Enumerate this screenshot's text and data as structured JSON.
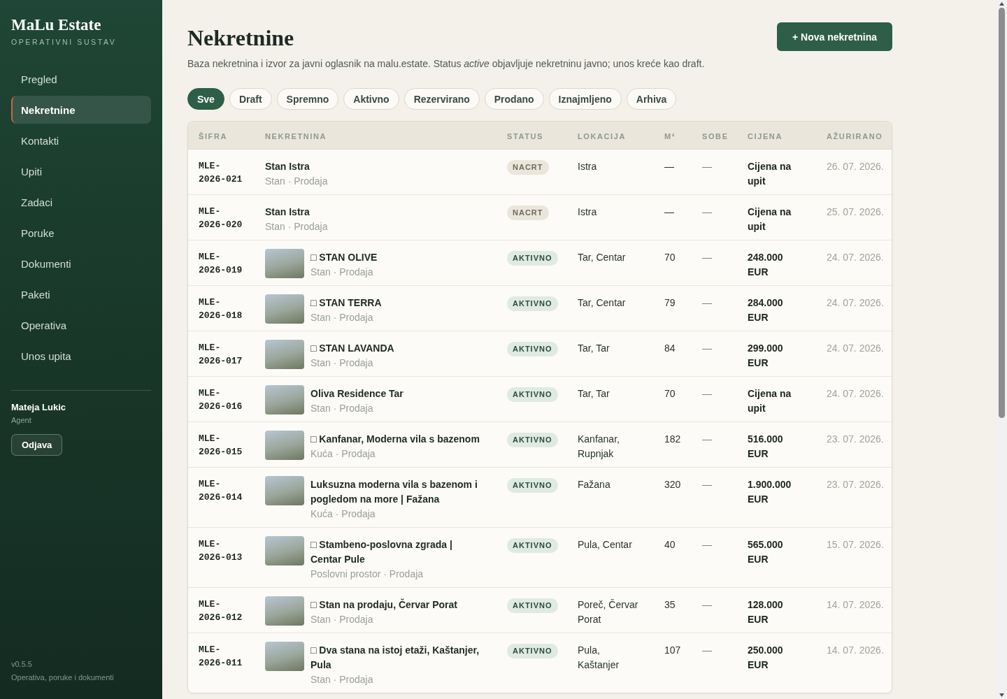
{
  "sidebar": {
    "brand": "MaLu Estate",
    "tagline": "OPERATIVNI SUSTAV",
    "items": [
      {
        "label": "Pregled",
        "selected": false
      },
      {
        "label": "Nekretnine",
        "selected": true
      },
      {
        "label": "Kontakti",
        "selected": false
      },
      {
        "label": "Upiti",
        "selected": false
      },
      {
        "label": "Zadaci",
        "selected": false
      },
      {
        "label": "Poruke",
        "selected": false
      },
      {
        "label": "Dokumenti",
        "selected": false
      },
      {
        "label": "Paketi",
        "selected": false
      },
      {
        "label": "Operativa",
        "selected": false
      },
      {
        "label": "Unos upita",
        "selected": false
      }
    ],
    "user": {
      "name": "Mateja Lukic",
      "role": "Agent",
      "logout": "Odjava"
    },
    "version": "v0.5.5",
    "footer": "Operativa, poruke i dokumenti"
  },
  "header": {
    "title": "Nekretnine",
    "description": "Baza nekretnina i izvor za javni oglasnik na malu.estate. Status *active* objavljuje nekretninu javno; unos kreće kao draft.",
    "new_button": "+ Nova nekretnina"
  },
  "filters": [
    {
      "label": "Sve",
      "selected": true
    },
    {
      "label": "Draft",
      "selected": false
    },
    {
      "label": "Spremno",
      "selected": false
    },
    {
      "label": "Aktivno",
      "selected": false
    },
    {
      "label": "Rezervirano",
      "selected": false
    },
    {
      "label": "Prodano",
      "selected": false
    },
    {
      "label": "Iznajmljeno",
      "selected": false
    },
    {
      "label": "Arhiva",
      "selected": false
    }
  ],
  "table": {
    "columns": [
      "ŠIFRA",
      "NEKRETNINA",
      "STATUS",
      "LOKACIJA",
      "M²",
      "SOBE",
      "CIJENA",
      "AŽURIRANO"
    ],
    "rows": [
      {
        "code": "MLE-2026-021",
        "photo": false,
        "title": "Stan Istra",
        "subtitle": "Stan · Prodaja",
        "status": {
          "label": "NACRT",
          "kind": "draft"
        },
        "location": "Istra",
        "area": "—",
        "rooms": "—",
        "price": "Cijena na upit",
        "updated": "26. 07. 2026."
      },
      {
        "code": "MLE-2026-020",
        "photo": false,
        "title": "Stan Istra",
        "subtitle": "Stan · Prodaja",
        "status": {
          "label": "NACRT",
          "kind": "draft"
        },
        "location": "Istra",
        "area": "—",
        "rooms": "—",
        "price": "Cijena na upit",
        "updated": "25. 07. 2026."
      },
      {
        "code": "MLE-2026-019",
        "photo": true,
        "title": "□ STAN OLIVE",
        "subtitle": "Stan · Prodaja",
        "status": {
          "label": "AKTIVNO",
          "kind": "active"
        },
        "location": "Tar, Centar",
        "area": "70",
        "rooms": "—",
        "price": "248.000 EUR",
        "updated": "24. 07. 2026."
      },
      {
        "code": "MLE-2026-018",
        "photo": true,
        "title": "□ STAN TERRA",
        "subtitle": "Stan · Prodaja",
        "status": {
          "label": "AKTIVNO",
          "kind": "active"
        },
        "location": "Tar, Centar",
        "area": "79",
        "rooms": "—",
        "price": "284.000 EUR",
        "updated": "24. 07. 2026."
      },
      {
        "code": "MLE-2026-017",
        "photo": true,
        "title": "□ STAN LAVANDA",
        "subtitle": "Stan · Prodaja",
        "status": {
          "label": "AKTIVNO",
          "kind": "active"
        },
        "location": "Tar, Tar",
        "area": "84",
        "rooms": "—",
        "price": "299.000 EUR",
        "updated": "24. 07. 2026."
      },
      {
        "code": "MLE-2026-016",
        "photo": true,
        "title": "Oliva Residence Tar",
        "subtitle": "Stan · Prodaja",
        "status": {
          "label": "AKTIVNO",
          "kind": "active"
        },
        "location": "Tar, Tar",
        "area": "70",
        "rooms": "—",
        "price": "Cijena na upit",
        "updated": "24. 07. 2026."
      },
      {
        "code": "MLE-2026-015",
        "photo": true,
        "title": "□ Kanfanar, Moderna vila s bazenom",
        "subtitle": "Kuća · Prodaja",
        "status": {
          "label": "AKTIVNO",
          "kind": "active"
        },
        "location": "Kanfanar, Rupnjak",
        "area": "182",
        "rooms": "—",
        "price": "516.000 EUR",
        "updated": "23. 07. 2026."
      },
      {
        "code": "MLE-2026-014",
        "photo": true,
        "title": "Luksuzna moderna vila s bazenom i pogledom na more | Fažana",
        "subtitle": "Kuća · Prodaja",
        "status": {
          "label": "AKTIVNO",
          "kind": "active"
        },
        "location": "Fažana",
        "area": "320",
        "rooms": "—",
        "price": "1.900.000 EUR",
        "updated": "23. 07. 2026."
      },
      {
        "code": "MLE-2026-013",
        "photo": true,
        "title": "□ Stambeno-poslovna zgrada | Centar Pule",
        "subtitle": "Poslovni prostor · Prodaja",
        "status": {
          "label": "AKTIVNO",
          "kind": "active"
        },
        "location": "Pula, Centar",
        "area": "40",
        "rooms": "—",
        "price": "565.000 EUR",
        "updated": "15. 07. 2026."
      },
      {
        "code": "MLE-2026-012",
        "photo": true,
        "title": "□ Stan na prodaju, Červar Porat",
        "subtitle": "Stan · Prodaja",
        "status": {
          "label": "AKTIVNO",
          "kind": "active"
        },
        "location": "Poreč, Červar Porat",
        "area": "35",
        "rooms": "—",
        "price": "128.000 EUR",
        "updated": "14. 07. 2026."
      },
      {
        "code": "MLE-2026-011",
        "photo": true,
        "title": "□ Dva stana na istoj etaži, Kaštanjer, Pula",
        "subtitle": "Stan · Prodaja",
        "status": {
          "label": "AKTIVNO",
          "kind": "active"
        },
        "location": "Pula, Kaštanjer",
        "area": "107",
        "rooms": "—",
        "price": "250.000 EUR",
        "updated": "14. 07. 2026."
      }
    ]
  }
}
